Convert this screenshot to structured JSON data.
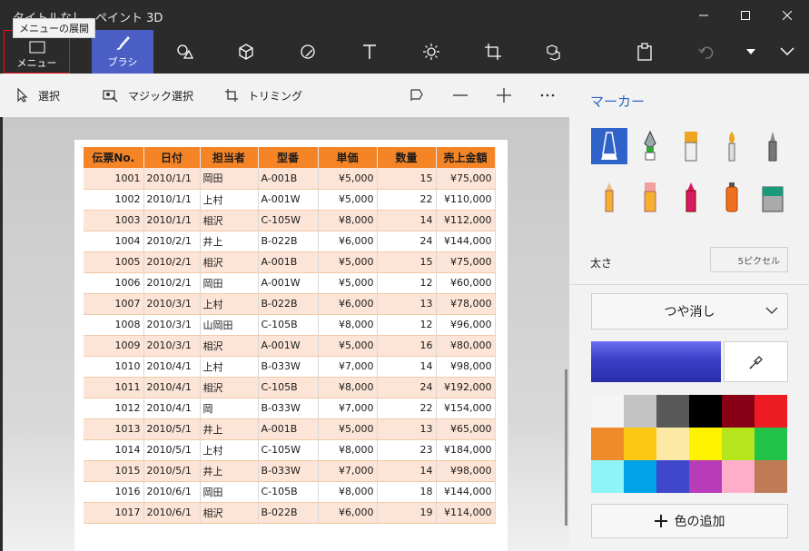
{
  "window": {
    "title": "タイトルなし - ペイント 3D"
  },
  "tooltip": "メニューの展開",
  "toolbar": {
    "menu_label": "メニュー",
    "brush_label": "ブラシ"
  },
  "subbar": {
    "select": "選択",
    "magic_select": "マジック選択",
    "trim": "トリミング"
  },
  "sheet": {
    "headers": [
      "伝票No.",
      "日付",
      "担当者",
      "型番",
      "単価",
      "数量",
      "売上金額"
    ],
    "rows": [
      [
        "1001",
        "2010/1/1",
        "岡田",
        "A-001B",
        "¥5,000",
        "15",
        "¥75,000"
      ],
      [
        "1002",
        "2010/1/1",
        "上村",
        "A-001W",
        "¥5,000",
        "22",
        "¥110,000"
      ],
      [
        "1003",
        "2010/1/1",
        "相沢",
        "C-105W",
        "¥8,000",
        "14",
        "¥112,000"
      ],
      [
        "1004",
        "2010/2/1",
        "井上",
        "B-022B",
        "¥6,000",
        "24",
        "¥144,000"
      ],
      [
        "1005",
        "2010/2/1",
        "相沢",
        "A-001B",
        "¥5,000",
        "15",
        "¥75,000"
      ],
      [
        "1006",
        "2010/2/1",
        "岡田",
        "A-001W",
        "¥5,000",
        "12",
        "¥60,000"
      ],
      [
        "1007",
        "2010/3/1",
        "上村",
        "B-022B",
        "¥6,000",
        "13",
        "¥78,000"
      ],
      [
        "1008",
        "2010/3/1",
        "山岡田",
        "C-105B",
        "¥8,000",
        "12",
        "¥96,000"
      ],
      [
        "1009",
        "2010/3/1",
        "相沢",
        "A-001W",
        "¥5,000",
        "16",
        "¥80,000"
      ],
      [
        "1010",
        "2010/4/1",
        "上村",
        "B-033W",
        "¥7,000",
        "14",
        "¥98,000"
      ],
      [
        "1011",
        "2010/4/1",
        "相沢",
        "C-105B",
        "¥8,000",
        "24",
        "¥192,000"
      ],
      [
        "1012",
        "2010/4/1",
        "岡",
        "B-033W",
        "¥7,000",
        "22",
        "¥154,000"
      ],
      [
        "1013",
        "2010/5/1",
        "井上",
        "A-001B",
        "¥5,000",
        "13",
        "¥65,000"
      ],
      [
        "1014",
        "2010/5/1",
        "上村",
        "C-105W",
        "¥8,000",
        "23",
        "¥184,000"
      ],
      [
        "1015",
        "2010/5/1",
        "井上",
        "B-033W",
        "¥7,000",
        "14",
        "¥98,000"
      ],
      [
        "1016",
        "2010/6/1",
        "岡田",
        "C-105B",
        "¥8,000",
        "18",
        "¥144,000"
      ],
      [
        "1017",
        "2010/6/1",
        "相沢",
        "B-022B",
        "¥6,000",
        "19",
        "¥114,000"
      ]
    ]
  },
  "panel": {
    "title": "マーカー",
    "thickness_label": "太さ",
    "thickness_value": "5ピクセル",
    "finish": "つや消し",
    "add_color": "色の追加",
    "selected_color": "#4046c8",
    "palette": [
      "#f5f5f5",
      "#c3c3c3",
      "#585858",
      "#000000",
      "#880015",
      "#ed1c24",
      "#f08b2c",
      "#fdc813",
      "#fde9a6",
      "#fff200",
      "#b5e61d",
      "#22c34a",
      "#8ef4f7",
      "#00a2e8",
      "#3f48cc",
      "#b83bb8",
      "#ffaec9",
      "#bf7a56"
    ]
  }
}
